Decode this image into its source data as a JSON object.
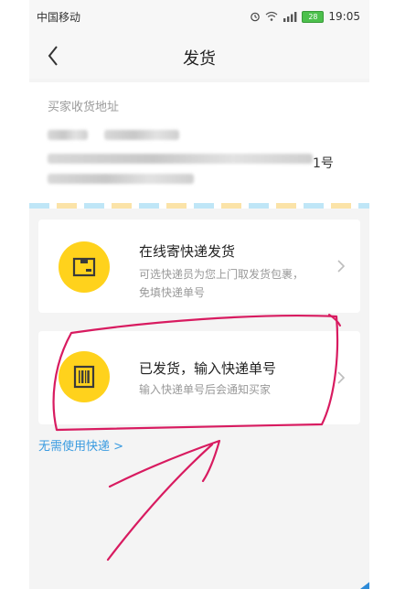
{
  "status_bar": {
    "carrier": "中国移动",
    "battery": "28",
    "time": "19:05"
  },
  "nav": {
    "title": "发货"
  },
  "address": {
    "label": "买家收货地址",
    "tail_text": "1号"
  },
  "options": [
    {
      "title": "在线寄快递发货",
      "desc_line1": "可选快递员为您上门取发货包裹，",
      "desc_line2": "免填快递单号"
    },
    {
      "title": "已发货，输入快递单号",
      "desc_line1": "输入快递单号后会通知买家"
    }
  ],
  "no_express_link": "无需使用快递 >",
  "colors": {
    "icon_circle": "#ffd21c",
    "link": "#3a9be0",
    "annotation": "#d81b60"
  }
}
